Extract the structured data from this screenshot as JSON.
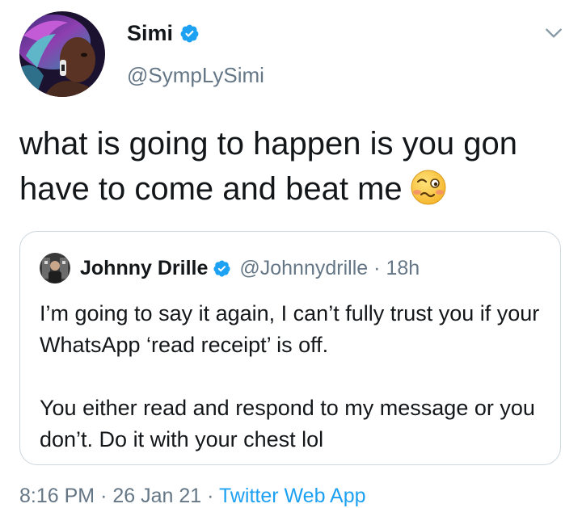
{
  "tweet": {
    "author_name": "Simi",
    "author_handle": "@SympLySimi",
    "text": "what is going to happen is you gon have to come and beat me",
    "emoji": "woozy-face",
    "meta": {
      "time": "8:16 PM",
      "separator": "·",
      "date": "26 Jan 21",
      "app": "Twitter Web App"
    }
  },
  "quoted": {
    "author_name": "Johnny Drille",
    "author_handle": "@Johnnydrille",
    "separator": "·",
    "time": "18h",
    "paragraphs": [
      "I’m going to say it again, I can’t fully trust you if your WhatsApp ‘read receipt’ is off.",
      "You either read and respond to my message or you don’t. Do it with your chest lol"
    ]
  },
  "colors": {
    "primary_text": "#14171a",
    "secondary_text": "#657786",
    "link": "#1da1f2",
    "verified": "#1da1f2",
    "border": "#ccd6dd"
  },
  "icons": [
    "verified-badge-icon",
    "chevron-down-icon",
    "woozy-face-emoji"
  ]
}
